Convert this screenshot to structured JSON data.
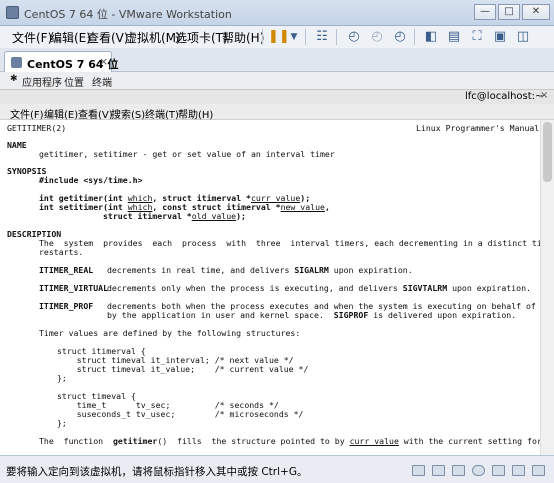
{
  "window": {
    "title": "CentOS 7 64 位 - VMware Workstation"
  },
  "menu": [
    "文件(F)",
    "编辑(E)",
    "查看(V)",
    "虚拟机(M)",
    "选项卡(T)",
    "帮助(H)"
  ],
  "tab": {
    "label": "CentOS 7 64 位",
    "close": "×"
  },
  "guest_bar": {
    "apps": "应用程序",
    "places": "位置",
    "terminal": "终端"
  },
  "terminal_window": {
    "title": "lfc@localhost:~",
    "close": "×"
  },
  "terminal_menu": [
    "文件(F)",
    "编辑(E)",
    "查看(V)",
    "搜索(S)",
    "终端(T)",
    "帮助(H)"
  ],
  "man": {
    "header_left": "GETITIMER(2)",
    "header_right": "Linux Programmer's Manual",
    "name_heading": "NAME",
    "name_text": "getitimer, setitimer - get or set value of an interval timer",
    "synopsis_heading": "SYNOPSIS",
    "include": "#include <sys/time.h>",
    "proto1_a": "int getitimer(int ",
    "proto1_which": "which",
    "proto1_b": ", struct itimerval *",
    "proto1_arg": "curr_value",
    "proto1_c": ");",
    "proto2_a": "int setitimer(int ",
    "proto2_which": "which",
    "proto2_b": ", const struct itimerval *",
    "proto2_arg": "new_value",
    "proto2_c": ",",
    "proto3_a": "struct itimerval *",
    "proto3_arg": "old_value",
    "proto3_c": ");",
    "description_heading": "DESCRIPTION",
    "desc1": "The  system  provides  each  process  with  three  interval timers, each decrementing in a distinct time doma",
    "desc2": "restarts.",
    "real_name": "ITIMER_REAL",
    "real_text_a": "decrements in real time, and delivers ",
    "real_sig": "SIGALRM",
    "real_text_b": " upon expiration.",
    "virtual_name": "ITIMER_VIRTUAL",
    "virtual_text_a": "decrements only when the process is executing, and delivers ",
    "virtual_sig": "SIGVTALRM",
    "virtual_text_b": " upon expiration.",
    "prof_name": "ITIMER_PROF",
    "prof_text1": "decrements both when the process executes and when the system is executing on behalf of the proc",
    "prof_text2_a": "by the application in user and kernel space.  ",
    "prof_sig": "SIGPROF",
    "prof_text2_b": " is delivered upon expiration.",
    "timer_values": "Timer values are defined by the following structures:",
    "s1": "struct itimerval {",
    "s2": "    struct timeval it_interval; /* next value */",
    "s3": "    struct timeval it_value;    /* current value */",
    "s4": "};",
    "s5": "struct timeval {",
    "s6": "    time_t      tv_sec;         /* seconds */",
    "s7": "    suseconds_t tv_usec;        /* microseconds */",
    "s8": "};",
    "last_a": "The  function  ",
    "last_fn": "getitimer",
    "last_b": "()  fills  the structure pointed to by ",
    "last_arg": "curr_value",
    "last_c": " with the current setting for the tir"
  },
  "status": {
    "text": "要将输入定向到该虚拟机，请将鼠标指针移入其中或按 Ctrl+G。"
  }
}
